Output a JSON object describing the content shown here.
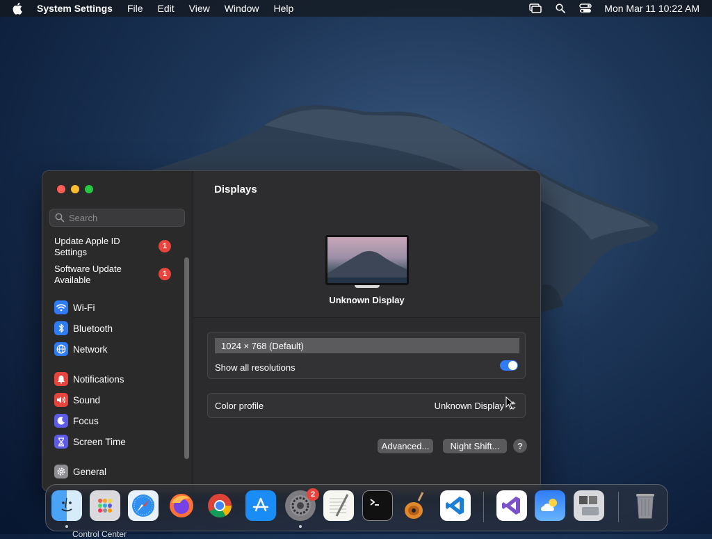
{
  "menubar": {
    "app_name": "System Settings",
    "menus": [
      "File",
      "Edit",
      "View",
      "Window",
      "Help"
    ],
    "clock": "Mon Mar 11  10:22 AM"
  },
  "sidebar": {
    "search_placeholder": "Search",
    "alerts": [
      {
        "label": "Update Apple ID Settings",
        "badge": "1"
      },
      {
        "label": "Software Update Available",
        "badge": "1"
      }
    ],
    "items": [
      {
        "label": "Wi-Fi",
        "icon": "wifi-icon",
        "color": "#2f7cf6"
      },
      {
        "label": "Bluetooth",
        "icon": "bluetooth-icon",
        "color": "#2f7cf6"
      },
      {
        "label": "Network",
        "icon": "globe-icon",
        "color": "#2f7cf6"
      },
      {
        "label": "Notifications",
        "icon": "bell-icon",
        "color": "#e5453c"
      },
      {
        "label": "Sound",
        "icon": "speaker-icon",
        "color": "#e5453c"
      },
      {
        "label": "Focus",
        "icon": "moon-icon",
        "color": "#5e5ce6"
      },
      {
        "label": "Screen Time",
        "icon": "hourglass-icon",
        "color": "#5e5ce6"
      },
      {
        "label": "General",
        "icon": "gear-icon",
        "color": "#8e8e93"
      }
    ],
    "partial_item": "Control Center"
  },
  "main": {
    "title": "Displays",
    "display_name": "Unknown Display",
    "resolution": "1024 × 768 (Default)",
    "show_all_label": "Show all resolutions",
    "show_all_on": true,
    "color_profile_label": "Color profile",
    "color_profile_value": "Unknown Display",
    "advanced_button": "Advanced...",
    "night_shift_button": "Night Shift...",
    "help_button": "?"
  },
  "dock": {
    "apps": [
      "Finder",
      "Launchpad",
      "Safari",
      "Firefox",
      "Chrome",
      "App Store",
      "System Settings",
      "TextEdit",
      "Terminal",
      "GarageBand",
      "Visual Studio Code",
      "Visual Studio",
      "Weather",
      "Boot Camp",
      "Trash"
    ],
    "settings_badge": "2"
  }
}
